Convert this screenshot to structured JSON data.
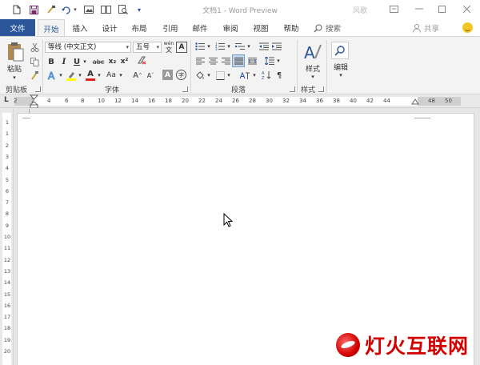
{
  "title_bar": {
    "document_title": "文档1 - Word Preview",
    "user_name": "风歌",
    "quick_access_icons": [
      "new-document-icon",
      "save-icon",
      "format-painter-icon",
      "redo-icon",
      "chevron-down-icon",
      "picture-icon",
      "read-mode-icon",
      "print-preview-icon",
      "customize-qat-icon"
    ],
    "window_controls": [
      "ribbon-display-icon",
      "minimize-icon",
      "maximize-icon",
      "close-icon"
    ]
  },
  "tabs": {
    "file": "文件",
    "items": [
      "开始",
      "插入",
      "设计",
      "布局",
      "引用",
      "邮件",
      "审阅",
      "视图",
      "帮助"
    ],
    "active": "开始",
    "search": "搜索",
    "share": "共享"
  },
  "ribbon": {
    "clipboard": {
      "paste_label": "粘贴",
      "group_label": "剪贴板"
    },
    "font": {
      "font_name": "等线 (中文正文)",
      "font_size": "五号",
      "pinyin": "wén",
      "grow": "A",
      "shrink": "A",
      "case": "Aa",
      "bold": "B",
      "italic": "I",
      "underline": "U",
      "strike": "abc",
      "subscript": "x₂",
      "superscript": "x²",
      "char_shading": "A",
      "enclose": "字",
      "group_label": "字体"
    },
    "paragraph": {
      "group_label": "段落"
    },
    "styles": {
      "label": "样式",
      "group_label": "样式"
    },
    "editing": {
      "label": "编辑"
    }
  },
  "ruler": {
    "horizontal_ticks": [
      "2",
      "2",
      "4",
      "6",
      "8",
      "10",
      "12",
      "14",
      "16",
      "18",
      "20",
      "22",
      "24",
      "26",
      "28",
      "30",
      "32",
      "34",
      "36",
      "38",
      "40",
      "42",
      "44",
      "48",
      "50"
    ],
    "vertical_ticks": [
      "1",
      "1",
      "2",
      "3",
      "4",
      "5",
      "6",
      "7",
      "8",
      "9",
      "10",
      "11",
      "12",
      "13",
      "14",
      "15",
      "16",
      "17",
      "18",
      "19",
      "20"
    ],
    "tab_selector": "L"
  },
  "watermark": {
    "text": "灯火互联网"
  },
  "colors": {
    "brand": "#2b579a",
    "logo_red": "#d40000"
  }
}
